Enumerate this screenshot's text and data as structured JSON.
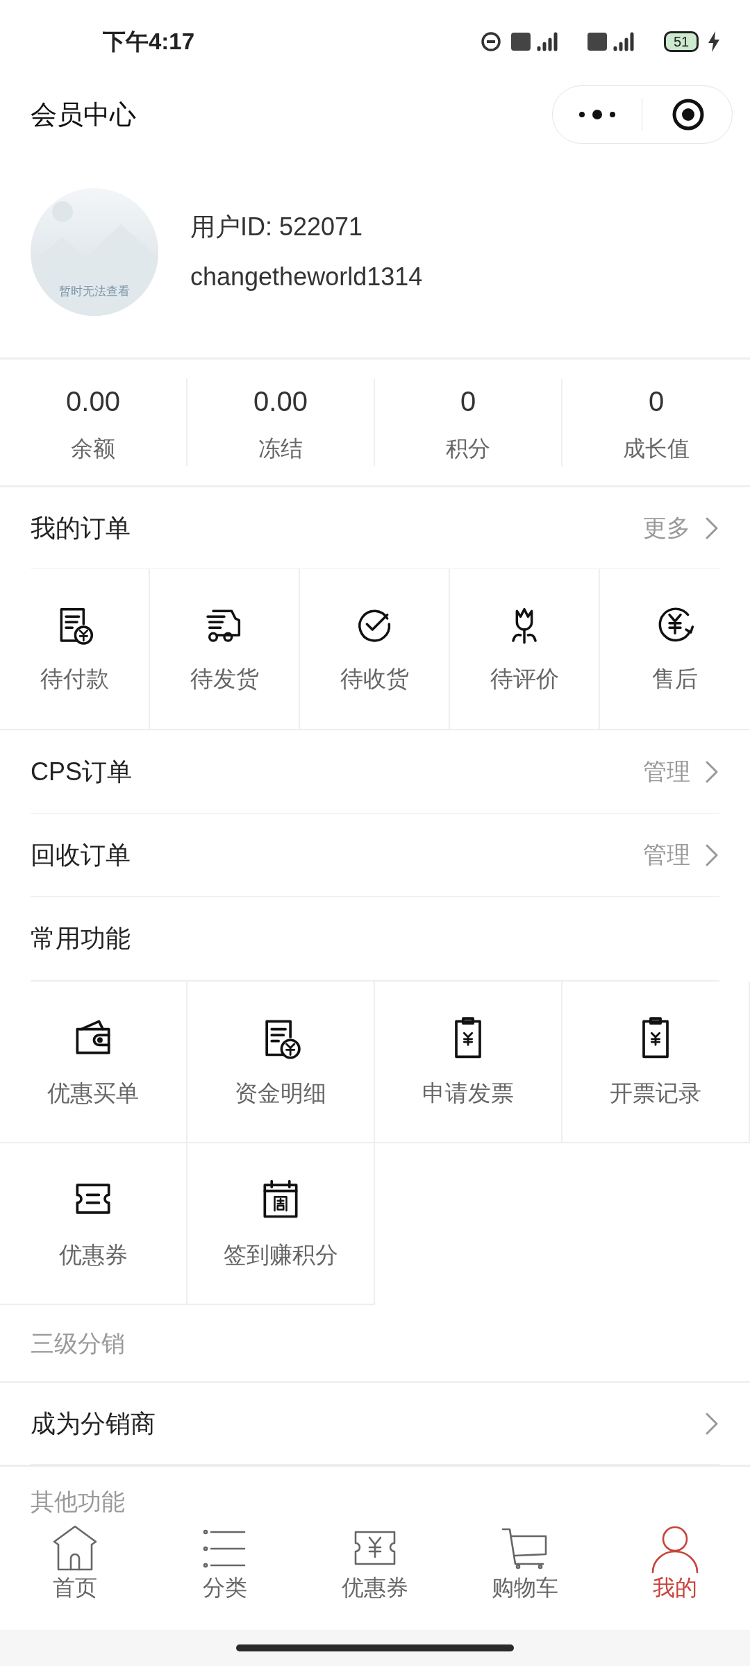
{
  "status_bar": {
    "time": "下午4:17",
    "battery": "51"
  },
  "header": {
    "title": "会员中心"
  },
  "profile": {
    "avatar_caption": "暂时无法查看",
    "user_id": "用户ID: 522071",
    "username": "changetheworld1314"
  },
  "stats": [
    {
      "value": "0.00",
      "label": "余额"
    },
    {
      "value": "0.00",
      "label": "冻结"
    },
    {
      "value": "0",
      "label": "积分"
    },
    {
      "value": "0",
      "label": "成长值"
    }
  ],
  "orders": {
    "title": "我的订单",
    "more": "更多",
    "items": [
      {
        "label": "待付款"
      },
      {
        "label": "待发货"
      },
      {
        "label": "待收货"
      },
      {
        "label": "待评价"
      },
      {
        "label": "售后"
      }
    ]
  },
  "order_links": [
    {
      "label": "CPS订单",
      "action": "管理"
    },
    {
      "label": "回收订单",
      "action": "管理"
    }
  ],
  "common": {
    "title": "常用功能",
    "items": [
      {
        "label": "优惠买单"
      },
      {
        "label": "资金明细"
      },
      {
        "label": "申请发票"
      },
      {
        "label": "开票记录"
      },
      {
        "label": "优惠券"
      },
      {
        "label": "签到赚积分"
      }
    ]
  },
  "distribution": {
    "title": "三级分销",
    "row": "成为分销商"
  },
  "other": {
    "title": "其他功能"
  },
  "tab_bar": [
    {
      "label": "首页",
      "selected": false
    },
    {
      "label": "分类",
      "selected": false
    },
    {
      "label": "优惠券",
      "selected": false
    },
    {
      "label": "购物车",
      "selected": false
    },
    {
      "label": "我的",
      "selected": true
    }
  ]
}
